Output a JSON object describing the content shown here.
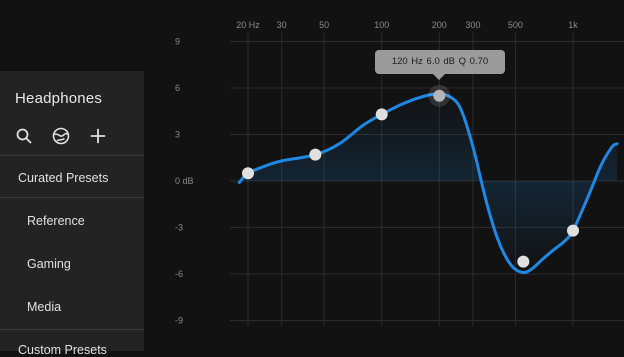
{
  "sidebar": {
    "title": "Headphones",
    "icons": [
      "search-icon",
      "globe-icon",
      "plus-icon"
    ],
    "curated_label": "Curated Presets",
    "presets": [
      "Reference",
      "Gaming",
      "Media"
    ],
    "custom_label": "Custom Presets"
  },
  "eq": {
    "freq_ticks": [
      {
        "label": "20 Hz",
        "value": 20
      },
      {
        "label": "30",
        "value": 30
      },
      {
        "label": "50",
        "value": 50
      },
      {
        "label": "100",
        "value": 100
      },
      {
        "label": "200",
        "value": 200
      },
      {
        "label": "300",
        "value": 300
      },
      {
        "label": "500",
        "value": 500
      },
      {
        "label": "1k",
        "value": 1000
      }
    ],
    "gain_ticks": [
      {
        "label": "9",
        "value": 9
      },
      {
        "label": "6",
        "value": 6
      },
      {
        "label": "3",
        "value": 3
      },
      {
        "label": "0 dB",
        "value": 0
      },
      {
        "label": "-3",
        "value": -3
      },
      {
        "label": "-6",
        "value": -6
      },
      {
        "label": "-9",
        "value": -9
      }
    ],
    "bands": [
      {
        "freq": 20,
        "gain": 0.5,
        "selected": false
      },
      {
        "freq": 45,
        "gain": 1.7,
        "selected": false
      },
      {
        "freq": 100,
        "gain": 4.3,
        "selected": false
      },
      {
        "freq": 200,
        "gain": 5.5,
        "selected": true
      },
      {
        "freq": 550,
        "gain": -5.2,
        "selected": false
      },
      {
        "freq": 1000,
        "gain": -3.2,
        "selected": false
      }
    ],
    "curve": [
      [
        18,
        -0.1
      ],
      [
        20,
        0.5
      ],
      [
        25,
        1.0
      ],
      [
        30,
        1.3
      ],
      [
        45,
        1.7
      ],
      [
        60,
        2.4
      ],
      [
        80,
        3.6
      ],
      [
        100,
        4.3
      ],
      [
        130,
        5.0
      ],
      [
        170,
        5.5
      ],
      [
        200,
        5.6
      ],
      [
        230,
        5.4
      ],
      [
        260,
        4.6
      ],
      [
        300,
        2.2
      ],
      [
        350,
        -1.2
      ],
      [
        400,
        -3.6
      ],
      [
        450,
        -5.0
      ],
      [
        500,
        -5.7
      ],
      [
        560,
        -5.9
      ],
      [
        620,
        -5.6
      ],
      [
        700,
        -5.0
      ],
      [
        800,
        -4.4
      ],
      [
        900,
        -3.9
      ],
      [
        1000,
        -3.2
      ],
      [
        1200,
        -1.0
      ],
      [
        1400,
        1.0
      ],
      [
        1600,
        2.2
      ],
      [
        1700,
        2.4
      ]
    ],
    "tooltip": "120 Hz   6.0 dB   Q 0.70",
    "colors": {
      "curve": "#1e88e5",
      "grid": "#2c2c2c",
      "label": "#8a8a8a",
      "handle": "#e0e0e0",
      "handle_selected": "#b5b5b5"
    }
  }
}
